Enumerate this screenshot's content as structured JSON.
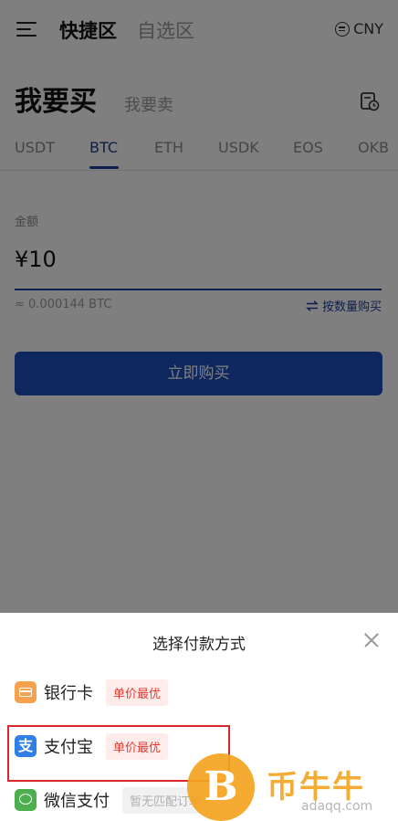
{
  "header": {
    "tabs": [
      {
        "label": "快捷区",
        "active": true
      },
      {
        "label": "自选区",
        "active": false
      }
    ],
    "currency": "CNY"
  },
  "trade": {
    "buy_label": "我要买",
    "sell_label": "我要卖"
  },
  "coin_tabs": [
    {
      "label": "USDT",
      "active": false
    },
    {
      "label": "BTC",
      "active": true
    },
    {
      "label": "ETH",
      "active": false
    },
    {
      "label": "USDK",
      "active": false
    },
    {
      "label": "EOS",
      "active": false
    },
    {
      "label": "OKB",
      "active": false
    }
  ],
  "amount": {
    "label": "金额",
    "value": "¥10",
    "approx": "≈ 0.000144 BTC",
    "switch_label": "按数量购买"
  },
  "buy_button": "立即购买",
  "payment_sheet": {
    "title": "选择付款方式",
    "methods": [
      {
        "label": "银行卡",
        "badge": "单价最优",
        "icon": "bank-card-icon"
      },
      {
        "label": "支付宝",
        "badge": "单价最优",
        "icon": "alipay-icon",
        "icon_glyph": "支"
      },
      {
        "label": "微信支付",
        "badge": "暂无匹配订单",
        "icon": "wechat-pay-icon"
      }
    ]
  },
  "watermark": {
    "glyph": "B",
    "text": "币牛牛",
    "url": "adaqq.com"
  },
  "colors": {
    "accent": "#1c3f9e",
    "button": "#1f4fbf",
    "badge_red": "#e03c31",
    "highlight": "#d7262c"
  }
}
